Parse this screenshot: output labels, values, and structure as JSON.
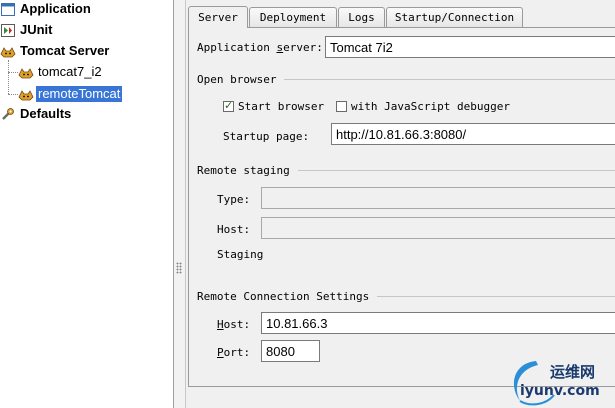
{
  "tree": {
    "items": [
      {
        "label": "Application",
        "icon": "application-icon"
      },
      {
        "label": "JUnit",
        "icon": "junit-icon"
      },
      {
        "label": "Tomcat Server",
        "icon": "tomcat-icon"
      },
      {
        "label": "tomcat7_i2",
        "icon": "tomcat-icon"
      },
      {
        "label": "remoteTomcat",
        "icon": "tomcat-icon"
      },
      {
        "label": "Defaults",
        "icon": "defaults-wrench-icon"
      }
    ]
  },
  "tabs": [
    "Server",
    "Deployment",
    "Logs",
    "Startup/Connection"
  ],
  "server": {
    "app_server_label": "Application server:",
    "app_server_value": "Tomcat 7i2",
    "open_browser_title": "Open browser",
    "start_browser_label": "Start browser",
    "start_browser_checked": true,
    "js_debugger_label": "with JavaScript debugger",
    "js_debugger_checked": false,
    "startup_page_label": "Startup page:",
    "startup_page_value": "http://10.81.66.3:8080/",
    "remote_staging_title": "Remote staging",
    "type_label": "Type:",
    "type_value": "",
    "host_label": "Host:",
    "host_value": "",
    "staging_label": "Staging",
    "remote_conn_title": "Remote Connection Settings",
    "conn_host_label": "Host:",
    "conn_host_value": "10.81.66.3",
    "port_label": "Port:",
    "port_value": "8080"
  },
  "watermark": {
    "cn": "运维网",
    "en": "iyunv.com"
  },
  "colors": {
    "selection": "#3875d7",
    "panel_bg": "#f0f0f0"
  }
}
